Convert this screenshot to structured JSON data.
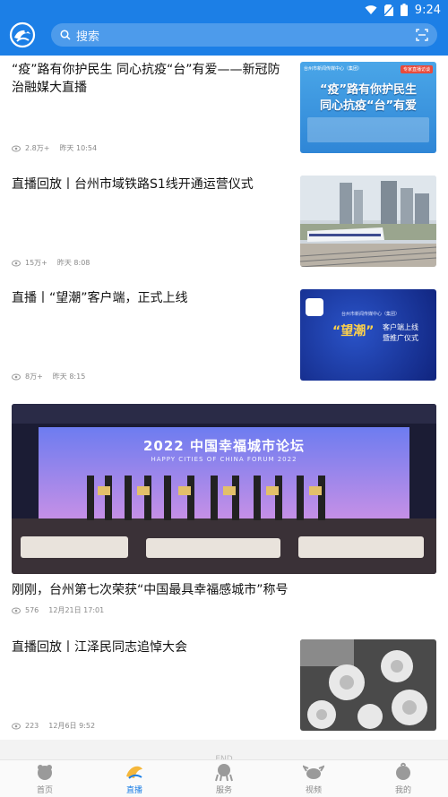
{
  "status_bar": {
    "time": "9:24"
  },
  "header": {
    "search_placeholder": "搜索",
    "colors": {
      "brand": "#1c7fe6"
    }
  },
  "feed": [
    {
      "title": "“疫”路有你护民生 同心抗疫“台”有爱——新冠防治融媒大直播",
      "views": "2.8万+",
      "time": "昨天 10:54",
      "thumb": {
        "org": "台州市新闻传媒中心（集团）",
        "tag": "专家直播访谈",
        "line1": "“疫”路有你护民生",
        "line2": "同心抗疫“台”有爱"
      }
    },
    {
      "title": "直播回放丨台州市域铁路S1线开通运营仪式",
      "views": "15万+",
      "time": "昨天 8:08"
    },
    {
      "title": "直播丨“望潮”客户端，正式上线",
      "views": "8万+",
      "time": "昨天 8:15",
      "thumb": {
        "org": "台州市新闻传媒中心（集团）",
        "brand": "“望潮”",
        "line1": "客户端上线",
        "line2": "暨推广仪式"
      }
    },
    {
      "title": "刚刚，台州第七次荣获“中国最具幸福感城市”称号",
      "views": "576",
      "time": "12月21日 17:01",
      "image": {
        "headline": "2022 中国幸福城市论坛",
        "subline": "HAPPY CITIES OF CHINA FORUM 2022"
      }
    },
    {
      "title": "直播回放丨江泽民同志追悼大会",
      "views": "223",
      "time": "12月6日 9:52"
    }
  ],
  "end_text": "END",
  "bottom_nav": [
    {
      "label": "首页",
      "icon": "home-mascot-icon",
      "active": false
    },
    {
      "label": "直播",
      "icon": "live-mascot-icon",
      "active": true
    },
    {
      "label": "服务",
      "icon": "service-mascot-icon",
      "active": false
    },
    {
      "label": "视频",
      "icon": "video-mascot-icon",
      "active": false
    },
    {
      "label": "我的",
      "icon": "profile-mascot-icon",
      "active": false
    }
  ]
}
